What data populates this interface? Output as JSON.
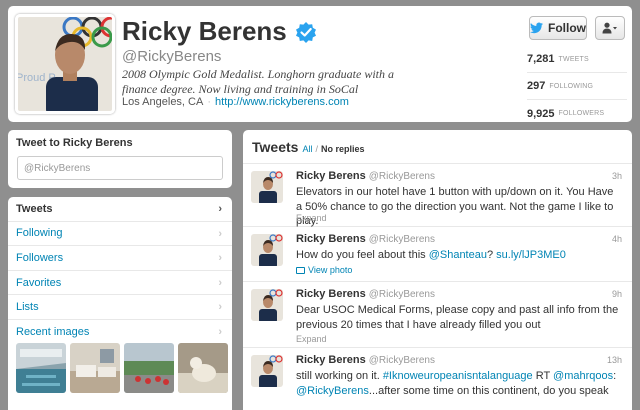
{
  "profile": {
    "name": "Ricky Berens",
    "handle": "@RickyBerens",
    "bio": "2008 Olympic Gold Medalist. Longhorn graduate with a finance degree. Now living and training in SoCal",
    "location": "Los Angeles, CA",
    "separator": "·",
    "url": "http://www.rickyberens.com",
    "follow_label": "Follow",
    "stats": [
      {
        "value": "7,281",
        "label": "TWEETS"
      },
      {
        "value": "297",
        "label": "FOLLOWING"
      },
      {
        "value": "9,925",
        "label": "FOLLOWERS"
      }
    ]
  },
  "tweet_to": {
    "title": "Tweet to Ricky Berens",
    "input_value": "@RickyBerens"
  },
  "nav": {
    "items": [
      {
        "label": "Tweets"
      },
      {
        "label": "Following"
      },
      {
        "label": "Followers"
      },
      {
        "label": "Favorites"
      },
      {
        "label": "Lists"
      },
      {
        "label": "Recent images"
      }
    ],
    "chevron": "›"
  },
  "tweets": {
    "title": "Tweets",
    "filter_all": "All",
    "filter_slash": "/",
    "filter_no_replies": "No replies",
    "items": [
      {
        "name": "Ricky Berens",
        "handle": "@RickyBerens",
        "time": "3h",
        "text": "Elevators in our hotel have 1 button with up/down on it. You Have a 50% chance to go the direction you want. Not the game I like to play.",
        "action": "Expand"
      },
      {
        "name": "Ricky Berens",
        "handle": "@RickyBerens",
        "time": "4h",
        "text_before": "How do you feel about this ",
        "mention": "@Shanteau",
        "text_mid": "? ",
        "link": "su.ly/lJP3ME0",
        "action": "View photo"
      },
      {
        "name": "Ricky Berens",
        "handle": "@RickyBerens",
        "time": "9h",
        "text": "Dear USOC Medical Forms, please copy and past all info from the previous 20 times that I have already filled you out",
        "action": "Expand"
      },
      {
        "name": "Ricky Berens",
        "handle": "@RickyBerens",
        "time": "13h",
        "text_before": "still working on it. ",
        "hashtag": "#Iknoweuropeanisntalanguage",
        "text_mid": " RT ",
        "mention": "@mahrqoos",
        "text_after": ":",
        "mention2": "@RickyBerens",
        "text_end": "...after some time on this continent, do you speak"
      }
    ]
  },
  "colors": {
    "background": "#8f8f8f",
    "link": "#0084b4",
    "verified": "#2aa3ef"
  }
}
